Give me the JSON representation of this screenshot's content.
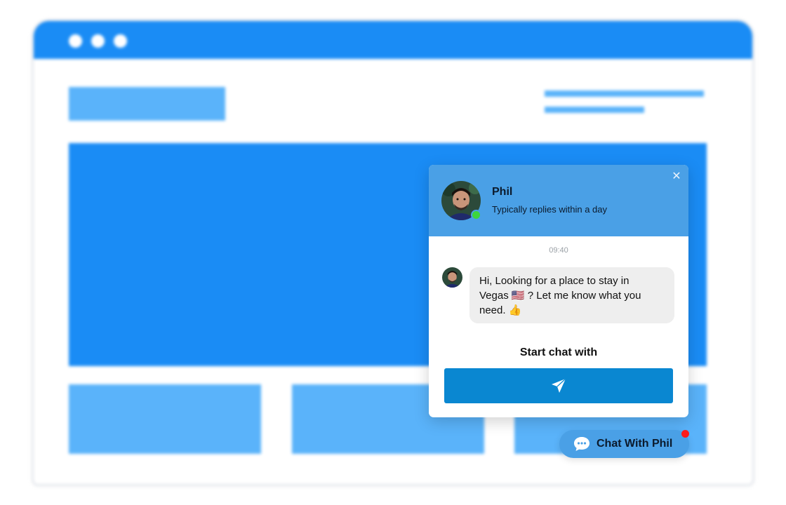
{
  "agent": {
    "name": "Phil",
    "status_text": "Typically replies within a day"
  },
  "chat": {
    "close_icon": "✕",
    "timestamp": "09:40",
    "message_line1": "Hi, Looking for a place to stay in",
    "message_line2": "Vegas 🇺🇸 ? Let me know what you",
    "message_line3": "need. 👍",
    "start_label": "Start chat with",
    "send_icon": "send-arrow-icon"
  },
  "launcher": {
    "label": "Chat With Phil",
    "icon": "chat-bubble-icon"
  },
  "colors": {
    "brand_blue": "#1a8cf5",
    "light_blue": "#5ab3fa",
    "header_blue": "#4aa0e6",
    "send_button": "#0a87d1",
    "online": "#3dd63d",
    "notification": "#ff1a1a"
  }
}
